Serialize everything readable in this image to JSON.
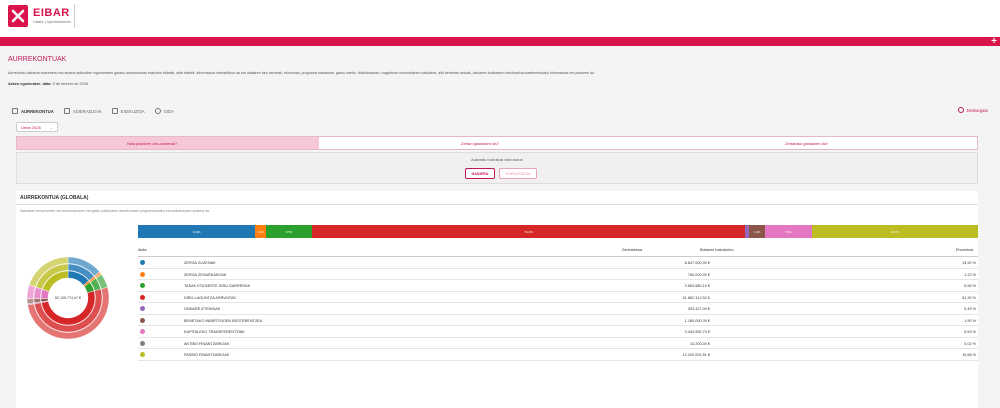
{
  "brand": {
    "name": "EIBAR",
    "subtitle": "Udala | Ayuntamiento",
    "color": "#d9144a"
  },
  "page": {
    "title": "AURREKONTUAK",
    "description": "Aurrekontu datuena lorareneko eta atuena aldirudien ingurutearen gaiako aurrekontuak erakuten bideaik, alde batetik, informazioa interaktiboa da eta udalaren diru sarrerak, ekonomia, programa barrakeari, gastu urteko, tinkoldeardari, magnitude ekonomikoen baliokera, aldi berrietan arituak, datuaren kudeatzen eta finantza-trasferentziako informazioa ere jasotzen du.",
    "updated_label": "Azken eguneratze- data:",
    "updated_value": "5 de febrero de 2026"
  },
  "tabs": [
    {
      "label": "AURREKONTUA",
      "icon": "budget-icon",
      "active": true
    },
    {
      "label": "ADIERAZLEAK",
      "icon": "indicators-icon",
      "active": false
    },
    {
      "label": "EXEKUZIOA",
      "icon": "execution-icon",
      "active": false
    },
    {
      "label": "GIDA",
      "icon": "guide-icon",
      "active": false
    }
  ],
  "download_label": "Deskargatu",
  "year": "Urtea 2026",
  "questions": [
    "Nola jasotzen diru-sarrerak?",
    "Zertan gastatzen da?",
    "Zertarako gastatzen da?"
  ],
  "choose": {
    "text": "Aukeratu nola ikusi nahi duzun",
    "option_a": "HASIERA",
    "option_b": "EXEKUTATUA"
  },
  "section": {
    "title": "AURREKONTUA (GLOBALA)",
    "description": "Sarkatzen behar/urreko eta aurrekontuaren eta gastu publikoaren aurrekontuen programarekako eta sailkatzearen arabera da.",
    "total": "62.105.774,47 €"
  },
  "table": {
    "headers": {
      "name": "Aldia",
      "amount": "Zenbatekoa",
      "variation": "Bizitanie bakoitzeko",
      "percent": "Ehunekoa"
    },
    "rows": [
      {
        "name": "ZERGA ZUZENAK",
        "amount": "8.647.000,00 €",
        "percent": "13,92 %",
        "color": "#1f77b4"
      },
      {
        "name": "ZERGA ZEHARKAKOAK",
        "amount": "760.000,00 €",
        "percent": "1,22 %",
        "color": "#ff7f0e"
      },
      {
        "name": "TASAK ETA BESTE DIRU-SARRERAK",
        "amount": "3.653.680,10 €",
        "percent": "5,55 %",
        "color": "#2ca02c"
      },
      {
        "name": "DIRU-LAGUNTZA ARRUNTAK",
        "amount": "31.862.312,52 €",
        "percent": "51,30 %",
        "color": "#d62728"
      },
      {
        "name": "ONDARE-ETEKINAK",
        "amount": "303.427,00 €",
        "percent": "0,49 %",
        "color": "#9467bd"
      },
      {
        "name": "BENETAKO INBERTSIOEN BESTERENTZEA",
        "amount": "1.180.000,00 €",
        "percent": "1,90 %",
        "color": "#8c564b"
      },
      {
        "name": "KAPITALEKO TRANSFERENTZIAK",
        "amount": "3.434.992,74 €",
        "percent": "5,53 %",
        "color": "#e377c2"
      },
      {
        "name": "AKTIBO FINANTZARIOAK",
        "amount": "14.200,00 €",
        "percent": "0,02 %",
        "color": "#7f7f7f"
      },
      {
        "name": "PASIBO FINANTZARIOAK",
        "amount": "12.220.001,51 €",
        "percent": "19,68 %",
        "color": "#bcbd22"
      }
    ]
  },
  "chart_data": {
    "type": "bar",
    "categories": [
      "ZERGA ZUZENAK",
      "ZERGA ZEHARKAKOAK",
      "TASAK ETA BESTE DIRU-SARRERAK",
      "DIRU-LAGUNTZA ARRUNTAK",
      "ONDARE-ETEKINAK",
      "BENETAKO INBERTSIOEN BESTERENTZEA",
      "KAPITALEKO TRANSFERENTZIAK",
      "AKTIBO FINANTZARIOAK",
      "PASIBO FINANTZARIOAK"
    ],
    "values": [
      13.92,
      1.22,
      5.55,
      51.3,
      0.49,
      1.9,
      5.53,
      0.02,
      19.68
    ],
    "labels": [
      "13,9%",
      "1,2%",
      "5,5%",
      "51,3%",
      "",
      "1,9%",
      "5,5%",
      "",
      "19,7%"
    ],
    "colors": [
      "#1f77b4",
      "#ff7f0e",
      "#2ca02c",
      "#d62728",
      "#9467bd",
      "#8c564b",
      "#e377c2",
      "#7f7f7f",
      "#bcbd22"
    ],
    "stacked": true
  }
}
